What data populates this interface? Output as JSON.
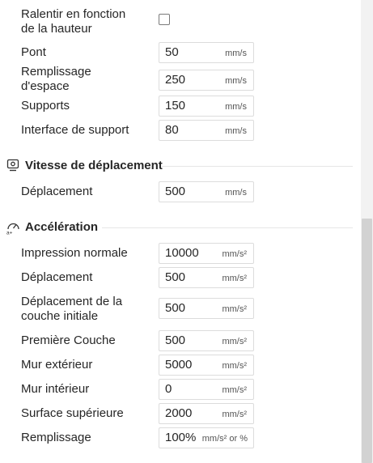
{
  "speed": {
    "slow_by_height_label": "Ralentir en fonction de la hauteur",
    "rows": [
      {
        "label": "Pont",
        "value": "50",
        "unit": "mm/s"
      },
      {
        "label": "Remplissage d'espace",
        "value": "250",
        "unit": "mm/s"
      },
      {
        "label": "Supports",
        "value": "150",
        "unit": "mm/s"
      },
      {
        "label": "Interface de support",
        "value": "80",
        "unit": "mm/s"
      }
    ]
  },
  "travel": {
    "title": "Vitesse de déplacement",
    "icon": "speedometer-icon",
    "rows": [
      {
        "label": "Déplacement",
        "value": "500",
        "unit": "mm/s"
      }
    ]
  },
  "acceleration": {
    "title": "Accélération",
    "icon": "acceleration-gauge-icon",
    "rows": [
      {
        "label": "Impression normale",
        "value": "10000",
        "unit": "mm/s²"
      },
      {
        "label": "Déplacement",
        "value": "500",
        "unit": "mm/s²"
      },
      {
        "label": "Déplacement de la couche initiale",
        "value": "500",
        "unit": "mm/s²"
      },
      {
        "label": "Première Couche",
        "value": "500",
        "unit": "mm/s²"
      },
      {
        "label": "Mur extérieur",
        "value": "5000",
        "unit": "mm/s²"
      },
      {
        "label": "Mur intérieur",
        "value": "0",
        "unit": "mm/s²"
      },
      {
        "label": "Surface supérieure",
        "value": "2000",
        "unit": "mm/s²"
      },
      {
        "label": "Remplissage",
        "value": "100%",
        "unit": "mm/s² or %"
      }
    ]
  }
}
